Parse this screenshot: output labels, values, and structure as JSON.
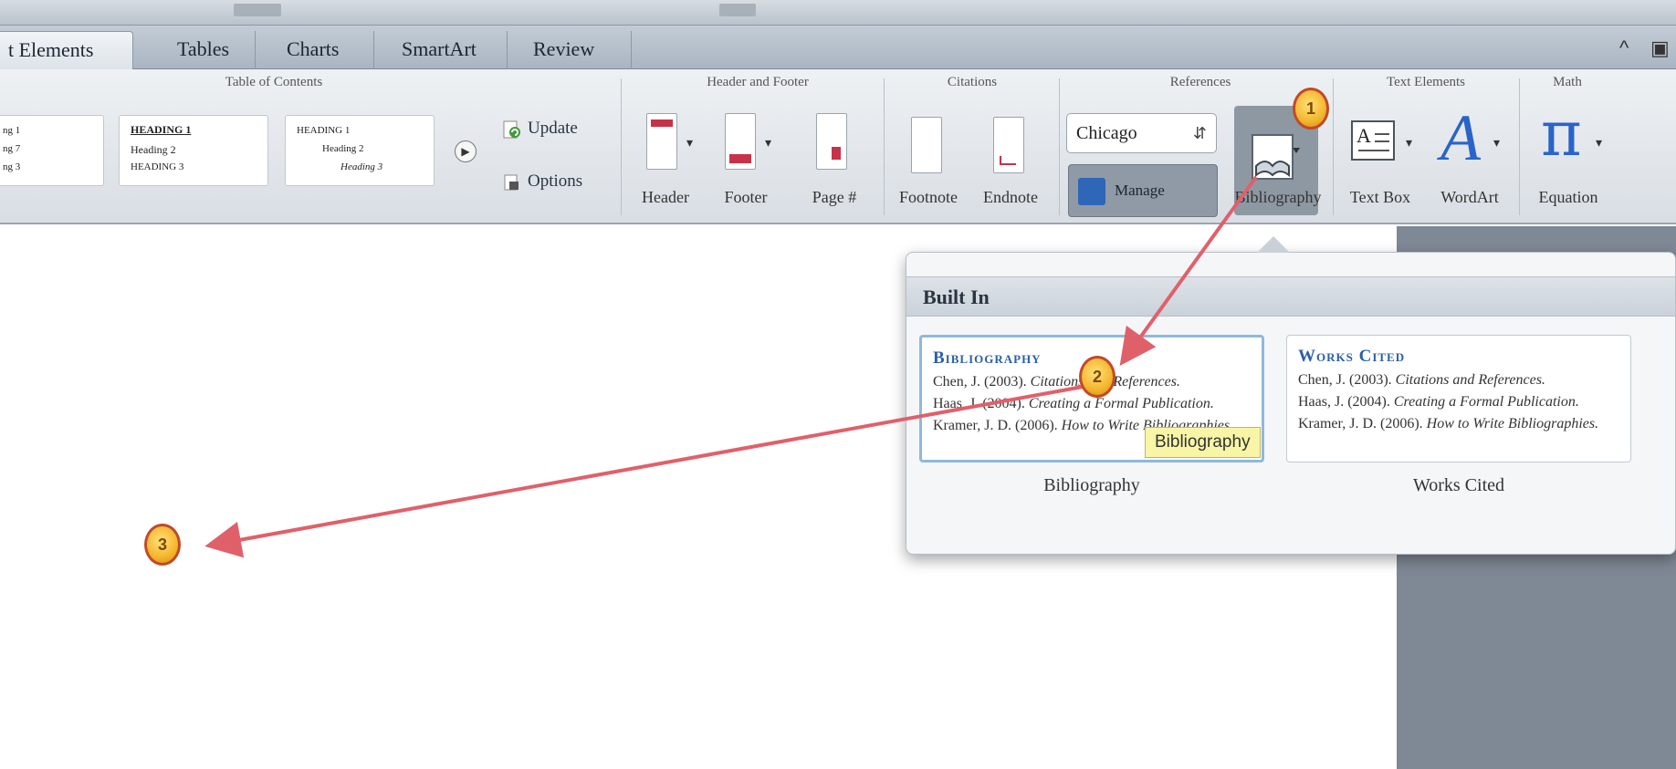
{
  "tabs": [
    {
      "label": "t Elements",
      "active": true
    },
    {
      "label": "Tables"
    },
    {
      "label": "Charts"
    },
    {
      "label": "SmartArt"
    },
    {
      "label": "Review"
    }
  ],
  "window_controls": {
    "collapse": "^",
    "menu": "▣"
  },
  "ribbon": {
    "groups": {
      "toc": "Table of Contents",
      "header_footer": "Header and Footer",
      "citations": "Citations",
      "references": "References",
      "text_elements": "Text Elements",
      "math": "Math"
    },
    "toc": {
      "update_label": "Update",
      "options_label": "Options",
      "thumb1": [
        "ng 1",
        "ng 7",
        "ng 3"
      ],
      "thumb2": [
        "HEADING 1",
        "Heading 2",
        "HEADING 3"
      ],
      "thumb3": [
        "HEADING 1",
        "Heading 2",
        "Heading 3"
      ]
    },
    "header_label": "Header",
    "footer_label": "Footer",
    "page_label": "Page #",
    "footnote_label": "Footnote",
    "endnote_label": "Endnote",
    "citation_style": "Chicago",
    "manage_label": "Manage",
    "bibliography_label": "Bibliography",
    "text_box_label": "Text Box",
    "wordart_label": "WordArt",
    "equation_label": "Equation"
  },
  "popover": {
    "header": "Built In",
    "cards": [
      {
        "title": "Bibliography",
        "lines": [
          {
            "author": "Chen, J. (2003).",
            "work": "Citations and References."
          },
          {
            "author": "Haas, J. (2004).",
            "work": "Creating a Formal Publication."
          },
          {
            "author": "Kramer, J. D. (2006).",
            "work": "How to Write Bibliographies."
          }
        ],
        "caption": "Bibliography"
      },
      {
        "title": "Works Cited",
        "lines": [
          {
            "author": "Chen, J. (2003).",
            "work": "Citations and References."
          },
          {
            "author": "Haas, J. (2004).",
            "work": "Creating a Formal Publication."
          },
          {
            "author": "Kramer, J. D. (2006).",
            "work": "How to Write Bibliographies."
          }
        ],
        "caption": "Works Cited"
      }
    ],
    "tooltip": "Bibliography"
  },
  "callouts": [
    "1",
    "2",
    "3"
  ],
  "colors": {
    "accent_blue": "#2b5fa8",
    "arrow": "#e0606a",
    "callout": "#f4b52c",
    "tooltip": "#f8f6a6"
  }
}
